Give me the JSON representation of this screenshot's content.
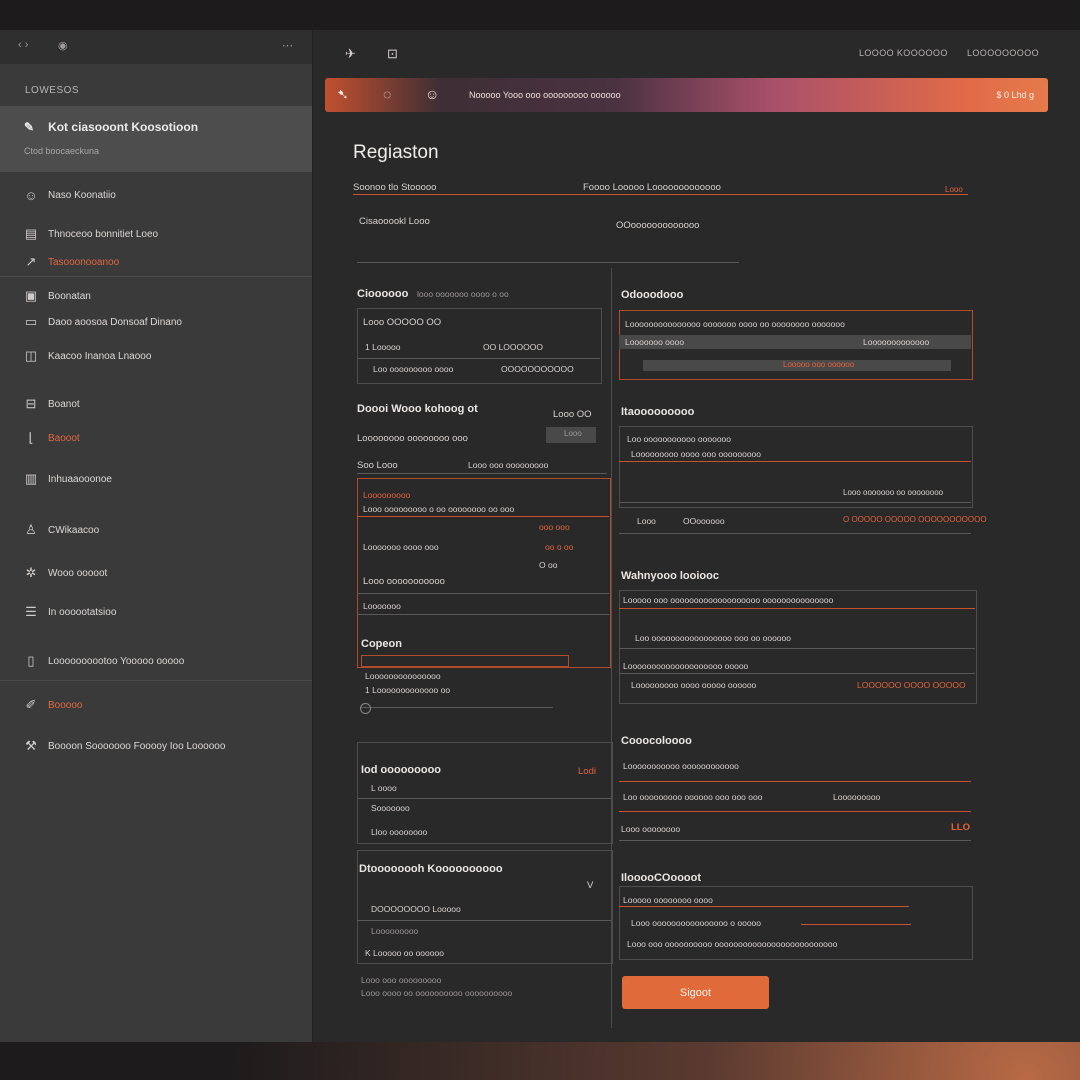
{
  "app": {
    "sidebar_top_icons": [
      "back-icon",
      "record-icon",
      "more-icon"
    ],
    "section_label": "LOWESOS",
    "active_item": {
      "title": "Kot ciasooont Koosotioon",
      "subtitle": "Ctod boocaeckuna"
    },
    "sidebar_items": [
      {
        "label": "Naso Koonatiio",
        "icon": "user-icon",
        "accent": false
      },
      {
        "label": "Thnoceoo bonnitiet Loeo",
        "icon": "document-icon",
        "accent": false
      },
      {
        "label": "Tasooonooanoo",
        "icon": "link-icon",
        "accent": true
      },
      {
        "label": "Boonatan",
        "icon": "image-icon",
        "accent": false
      },
      {
        "label": "Daoo aoosoa Donsoaf Dinano",
        "icon": "folder-icon",
        "accent": false
      },
      {
        "label": "Kaacoo Inanoa Lnaooo",
        "icon": "window-icon",
        "accent": false
      },
      {
        "label": "Boanot",
        "icon": "grid-icon",
        "accent": false
      },
      {
        "label": "Baooot",
        "icon": "chart-icon",
        "accent": true
      },
      {
        "label": "Inhuaaooonoe",
        "icon": "file-icon",
        "accent": false
      },
      {
        "label": "CWikaacoo",
        "icon": "person-icon",
        "accent": false
      },
      {
        "label": "Wooo ooooot",
        "icon": "puzzle-icon",
        "accent": false
      },
      {
        "label": "In oooootatsioo",
        "icon": "list-icon",
        "accent": false
      },
      {
        "label": "Loooooooootoo Yooooo ooooo",
        "icon": "page-icon",
        "accent": false
      },
      {
        "label": "Booooo",
        "icon": "pen-icon",
        "accent": true
      },
      {
        "label": "Boooon Sooooooo Fooooy Ioo Loooooo",
        "icon": "tool-icon",
        "accent": false
      }
    ]
  },
  "topbar": {
    "icons": [
      "pin-icon",
      "window-icon"
    ],
    "right_text_1": "LOOOO KOOOOOO",
    "right_text_2": "LOOOOOOOOO"
  },
  "banner": {
    "message": "Nooooo Yooo ooo ooooooooo oooooo",
    "right": "$ 0 Lhd g",
    "icons": [
      "bird-icon",
      "dot-icon",
      "smile-icon"
    ]
  },
  "page_title": "Regiaston",
  "header_row": {
    "left": "Soonoo tlo Stooooo",
    "middle": "Foooo Looooo Looooooooooooo",
    "right": "Looo"
  },
  "field_row": {
    "left": "Cisaooookl Looo",
    "right": "OOooooooooooooo"
  },
  "left_col": {
    "sec1": {
      "title": "Cioooooo",
      "sub": "looo ooooooo oooo o oo",
      "row1": "Looo OOOOO OO",
      "row2a": "1 Looooo",
      "row2b": "OO LOOOOOO",
      "row3a": "Loo ooooooooo oooo",
      "row3b": "OOOOOOOOOOO"
    },
    "sec2": {
      "title": "Doooi Wooo kohoog ot",
      "right": "Looo OO",
      "sub": "Loooooooo oooooooo ooo",
      "btn": "Looo",
      "input": "Soo Looo",
      "input_right": "Looo ooo ooooooooo"
    },
    "sec3": {
      "lines": [
        "Looooooooo",
        "Looo ooooooooo o oo oooooooo oo ooo",
        "Looooooo oooo ooo",
        "Looo ooooooooooo",
        "Looooooo"
      ],
      "values": [
        "ooo ooo",
        "oo o oo",
        "O oo"
      ]
    },
    "sec4": {
      "title": "Copeon",
      "lines": [
        "Looooooooooooooo",
        "1 Looooooooooooo oo"
      ]
    },
    "sec5": {
      "title": "Iod ooooooooo",
      "right": "Lodi",
      "rows": [
        "L oooo",
        "Sooooooo",
        "Lloo oooooooo"
      ]
    },
    "sec6": {
      "title": "Dtoooooooh Koooooooooo",
      "right": "V",
      "rows": [
        "DOOOOOOOO Looooo",
        "Looooooooo",
        "K Looooo oo oooooo"
      ],
      "foot": [
        "Looo ooo ooooooooo",
        "Looo oooo oo oooooooooo oooooooooo"
      ]
    }
  },
  "right_col": {
    "sec1": {
      "title": "Odooodooo",
      "rows": [
        "Looooooooooooooo ooooooo oooo oo oooooooo ooooooo",
        "Looooooo oooo",
        "Looooo ooo oooooo",
        "Looooooooooooo"
      ]
    },
    "sec2": {
      "title": "Itaooooooooo",
      "rows": [
        "Loo ooooooooooo ooooooo",
        "Looooooooo oooo ooo ooooooooo",
        "Looo ooooooo oo oooooooo"
      ],
      "footL": "Looo",
      "footM": "OOoooooo",
      "footR": "O OOOOO OOOOO OOOOOOOOOOO"
    },
    "sec3": {
      "title": "Wahnyooo looiooc",
      "rows": [
        "Looooo ooo ooooooooooooooooooo ooooooooooooooo",
        "Loo ooooooooooooooooo ooo oo oooooo",
        "Loooooooooooooooooooo ooooo",
        "Looooooooo oooo ooooo oooooo"
      ],
      "accent": "LOOOOOO OOOO OOOOO"
    },
    "sec4": {
      "title": "Cooocoloooo",
      "rows": [
        "Looooooooooo oooooooooooo",
        "Loo ooooooooo oooooo ooo ooo ooo",
        "Looo oooooooo"
      ],
      "accent": "Looooooooo",
      "value": "LLO"
    },
    "sec5": {
      "title": "IlooooCOoooot",
      "rows": [
        "Looooo oooooooo oooo",
        "Looo oooooooooooooooo o ooooo",
        "Looo ooo oooooooooo oooooooooooooooooooooooooo"
      ]
    }
  },
  "cta_label": "Sigoot"
}
